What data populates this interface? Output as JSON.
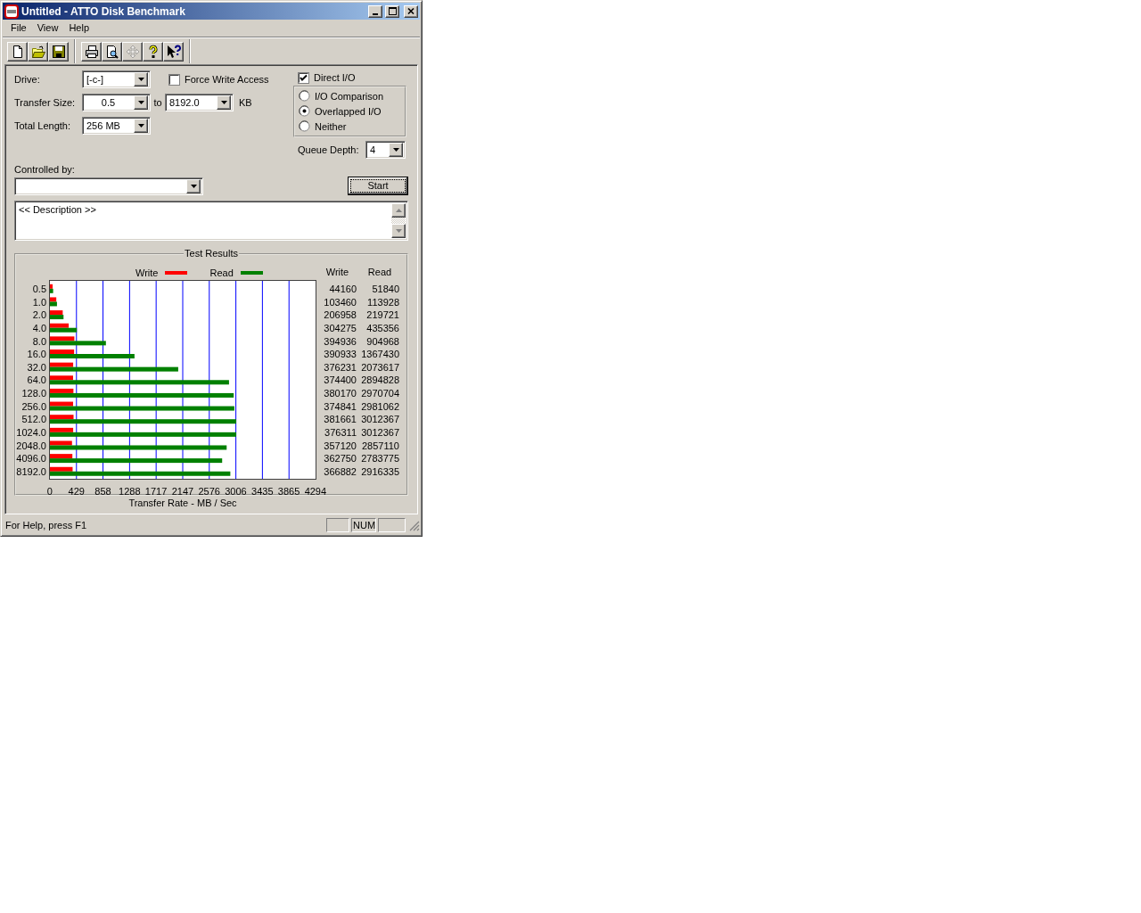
{
  "window": {
    "title": "Untitled - ATTO Disk Benchmark"
  },
  "menu": [
    {
      "label": "File"
    },
    {
      "label": "View"
    },
    {
      "label": "Help"
    }
  ],
  "toolbar": [
    {
      "buttons": [
        {
          "kind": "new",
          "disabled": false
        },
        {
          "kind": "open",
          "disabled": false
        },
        {
          "kind": "save",
          "disabled": false
        }
      ]
    },
    {
      "buttons": [
        {
          "kind": "print",
          "disabled": false
        },
        {
          "kind": "preview",
          "disabled": false
        },
        {
          "kind": "move",
          "disabled": true
        },
        {
          "kind": "help",
          "disabled": false
        },
        {
          "kind": "context_help",
          "disabled": false
        }
      ]
    }
  ],
  "settings": {
    "drive": {
      "label": "Drive:",
      "value": "[-c-]"
    },
    "force_write_access": {
      "label": "Force Write Access",
      "checked": false
    },
    "direct_io": {
      "label": "Direct I/O",
      "checked": true
    },
    "transfer_size": {
      "label": "Transfer Size:",
      "from": "0.5",
      "to_label": "to",
      "to": "8192.0",
      "unit": "KB"
    },
    "total_length": {
      "label": "Total Length:",
      "value": "256 MB"
    },
    "io_mode": [
      {
        "label": "I/O Comparison",
        "selected": false
      },
      {
        "label": "Overlapped I/O",
        "selected": true
      },
      {
        "label": "Neither",
        "selected": false
      }
    ],
    "queue_depth": {
      "label": "Queue Depth:",
      "value": "4"
    },
    "controlled_by": {
      "label": "Controlled by:"
    },
    "start_button": {
      "label": "Start"
    },
    "description": {
      "value": "<< Description >>"
    }
  },
  "test_results": {
    "title": "Test Results",
    "chart_data": {
      "type": "bar",
      "orientation": "horizontal",
      "xlabel": "Transfer Rate - MB / Sec",
      "categories": [
        "0.5",
        "1.0",
        "2.0",
        "4.0",
        "8.0",
        "16.0",
        "32.0",
        "64.0",
        "128.0",
        "256.0",
        "512.0",
        "1024.0",
        "2048.0",
        "4096.0",
        "8192.0"
      ],
      "series": [
        {
          "name": "Write",
          "color": "#ff0000",
          "values": [
            44,
            103,
            207,
            304,
            395,
            391,
            376,
            374,
            380,
            375,
            382,
            376,
            357,
            363,
            367
          ]
        },
        {
          "name": "Read",
          "color": "#008000",
          "values": [
            52,
            114,
            220,
            435,
            905,
            1367,
            2074,
            2895,
            2971,
            2981,
            3012,
            3012,
            2857,
            2784,
            2916
          ]
        }
      ],
      "grid": true,
      "legend": "top",
      "xlim": [
        0,
        4294
      ],
      "xticks": [
        0,
        429,
        858,
        1288,
        1717,
        2147,
        2576,
        3006,
        3435,
        3865,
        4294
      ]
    },
    "table": {
      "columns": [
        "Write",
        "Read"
      ],
      "rows": [
        [
          "44160",
          "51840"
        ],
        [
          "103460",
          "113928"
        ],
        [
          "206958",
          "219721"
        ],
        [
          "304275",
          "435356"
        ],
        [
          "394936",
          "904968"
        ],
        [
          "390933",
          "1367430"
        ],
        [
          "376231",
          "2073617"
        ],
        [
          "374400",
          "2894828"
        ],
        [
          "380170",
          "2970704"
        ],
        [
          "374841",
          "2981062"
        ],
        [
          "381661",
          "3012367"
        ],
        [
          "376311",
          "3012367"
        ],
        [
          "357120",
          "2857110"
        ],
        [
          "362750",
          "2783775"
        ],
        [
          "366882",
          "2916335"
        ]
      ]
    }
  },
  "status_bar": {
    "text": "For Help, press F1",
    "indicator": "NUM"
  }
}
